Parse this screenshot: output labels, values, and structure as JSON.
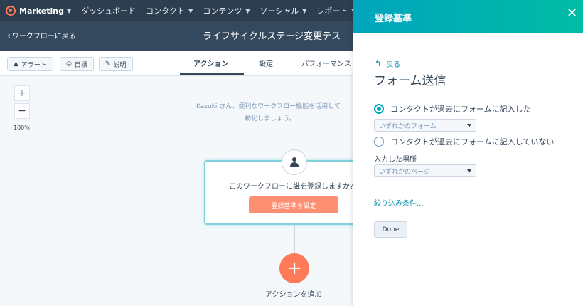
{
  "topnav": {
    "brand": "Marketing",
    "items": [
      {
        "label": "ダッシュボード"
      },
      {
        "label": "コンタクト"
      },
      {
        "label": "コンテンツ"
      },
      {
        "label": "ソーシャル"
      },
      {
        "label": "レポート"
      }
    ]
  },
  "subheader": {
    "back_label": "ワークフローに戻る",
    "title": "ライフサイクルステージ変更テス"
  },
  "toolbar": {
    "alert_label": "アラート",
    "goal_label": "目標",
    "description_label": "説明",
    "tabs": [
      {
        "label": "アクション"
      },
      {
        "label": "設定"
      },
      {
        "label": "パフォーマンス"
      }
    ]
  },
  "canvas": {
    "zoom_in": "+",
    "zoom_out": "−",
    "zoom_level": "100%",
    "hint_line1": "Kazuki さん、便利なワークフロー機能を活用して",
    "hint_line2": "動化しましょう。",
    "trigger_question": "このワークフローに誰を登録しますか?",
    "set_criteria_button": "登録基準を設定",
    "add_action_label": "アクションを追加"
  },
  "panel": {
    "title": "登録基準",
    "back_label": "戻る",
    "heading": "フォーム送信",
    "option_submitted": "コンタクトが過去にフォームに記入した",
    "option_not_submitted": "コンタクトが過去にフォームに記入していない",
    "form_select_value": "いずれかのフォーム",
    "location_label": "入力した場所",
    "page_select_value": "いずれかのページ",
    "filter_link": "絞り込み条件...",
    "done_button": "Done",
    "selected_option": "submitted"
  },
  "colors": {
    "nav_bg": "#2d3e50",
    "accent_teal": "#00a4bd",
    "accent_orange": "#ff7a59"
  }
}
